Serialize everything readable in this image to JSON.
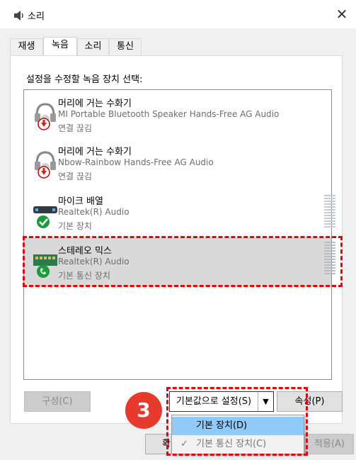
{
  "window": {
    "title": "소리",
    "close_glyph": "✕"
  },
  "tabs": [
    "재생",
    "녹음",
    "소리",
    "통신"
  ],
  "prompt": "설정을 수정할 녹음 장치 선택:",
  "devices": [
    {
      "name": "머리에 거는 수화기",
      "sub": "MI Portable Bluetooth Speaker Hands-Free AG Audio",
      "status": "연결 끊김",
      "icon": "headset-icon",
      "badge": "disconnected-badge"
    },
    {
      "name": "머리에 거는 수화기",
      "sub": "Nbow-Rainbow Hands-Free AG Audio",
      "status": "연결 끊김",
      "icon": "headset-icon",
      "badge": "disconnected-badge"
    },
    {
      "name": "마이크 배열",
      "sub": "Realtek(R) Audio",
      "status": "기본 장치",
      "icon": "microphone-array-icon",
      "badge": "default-check-badge"
    },
    {
      "name": "스테레오 믹스",
      "sub": "Realtek(R) Audio",
      "status": "기본 통신 장치",
      "icon": "stereo-mix-icon",
      "badge": "communication-phone-badge"
    }
  ],
  "buttons": {
    "configure": "구성(C)",
    "set_default": "기본값으로 설정(S)",
    "properties": "속성(P)",
    "apply": "적용(A)",
    "ok_partial": "확"
  },
  "menu": {
    "items": [
      "기본 장치(D)",
      "기본 통신 장치(C)"
    ],
    "check": "✓"
  },
  "annotation": {
    "step": "3"
  },
  "colors": {
    "highlight_red": "#e3000f",
    "step_badge": "#e63a2c",
    "menu_highlight": "#91c9f7",
    "selected_row": "#d9d9d9"
  }
}
